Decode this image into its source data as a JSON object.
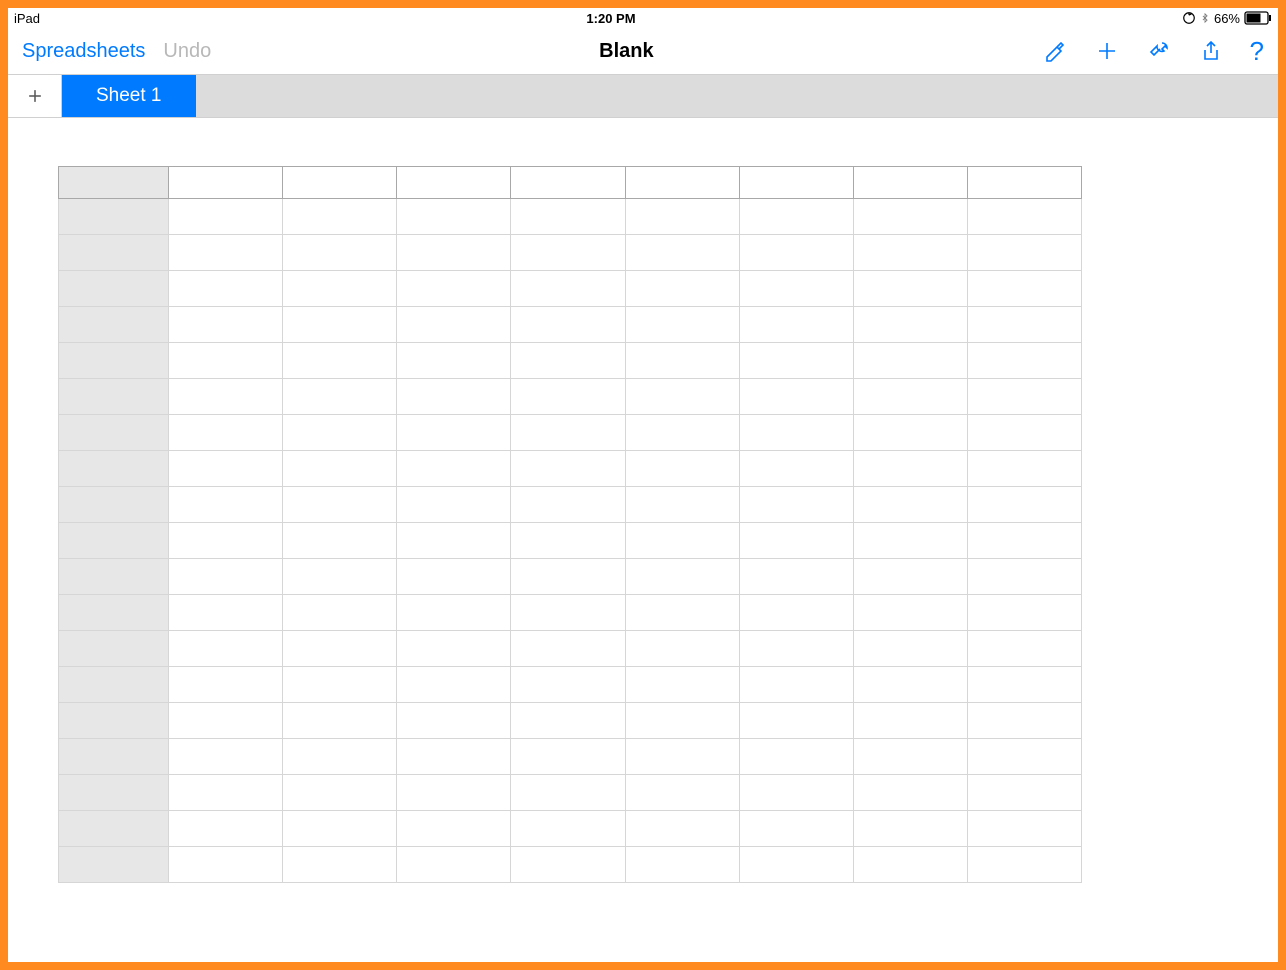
{
  "status": {
    "device": "iPad",
    "time": "1:20 PM",
    "battery_pct": "66%"
  },
  "toolbar": {
    "back_label": "Spreadsheets",
    "undo_label": "Undo",
    "title": "Blank"
  },
  "tabs": {
    "active_label": "Sheet 1"
  },
  "grid": {
    "columns": 9,
    "rows": 19
  }
}
